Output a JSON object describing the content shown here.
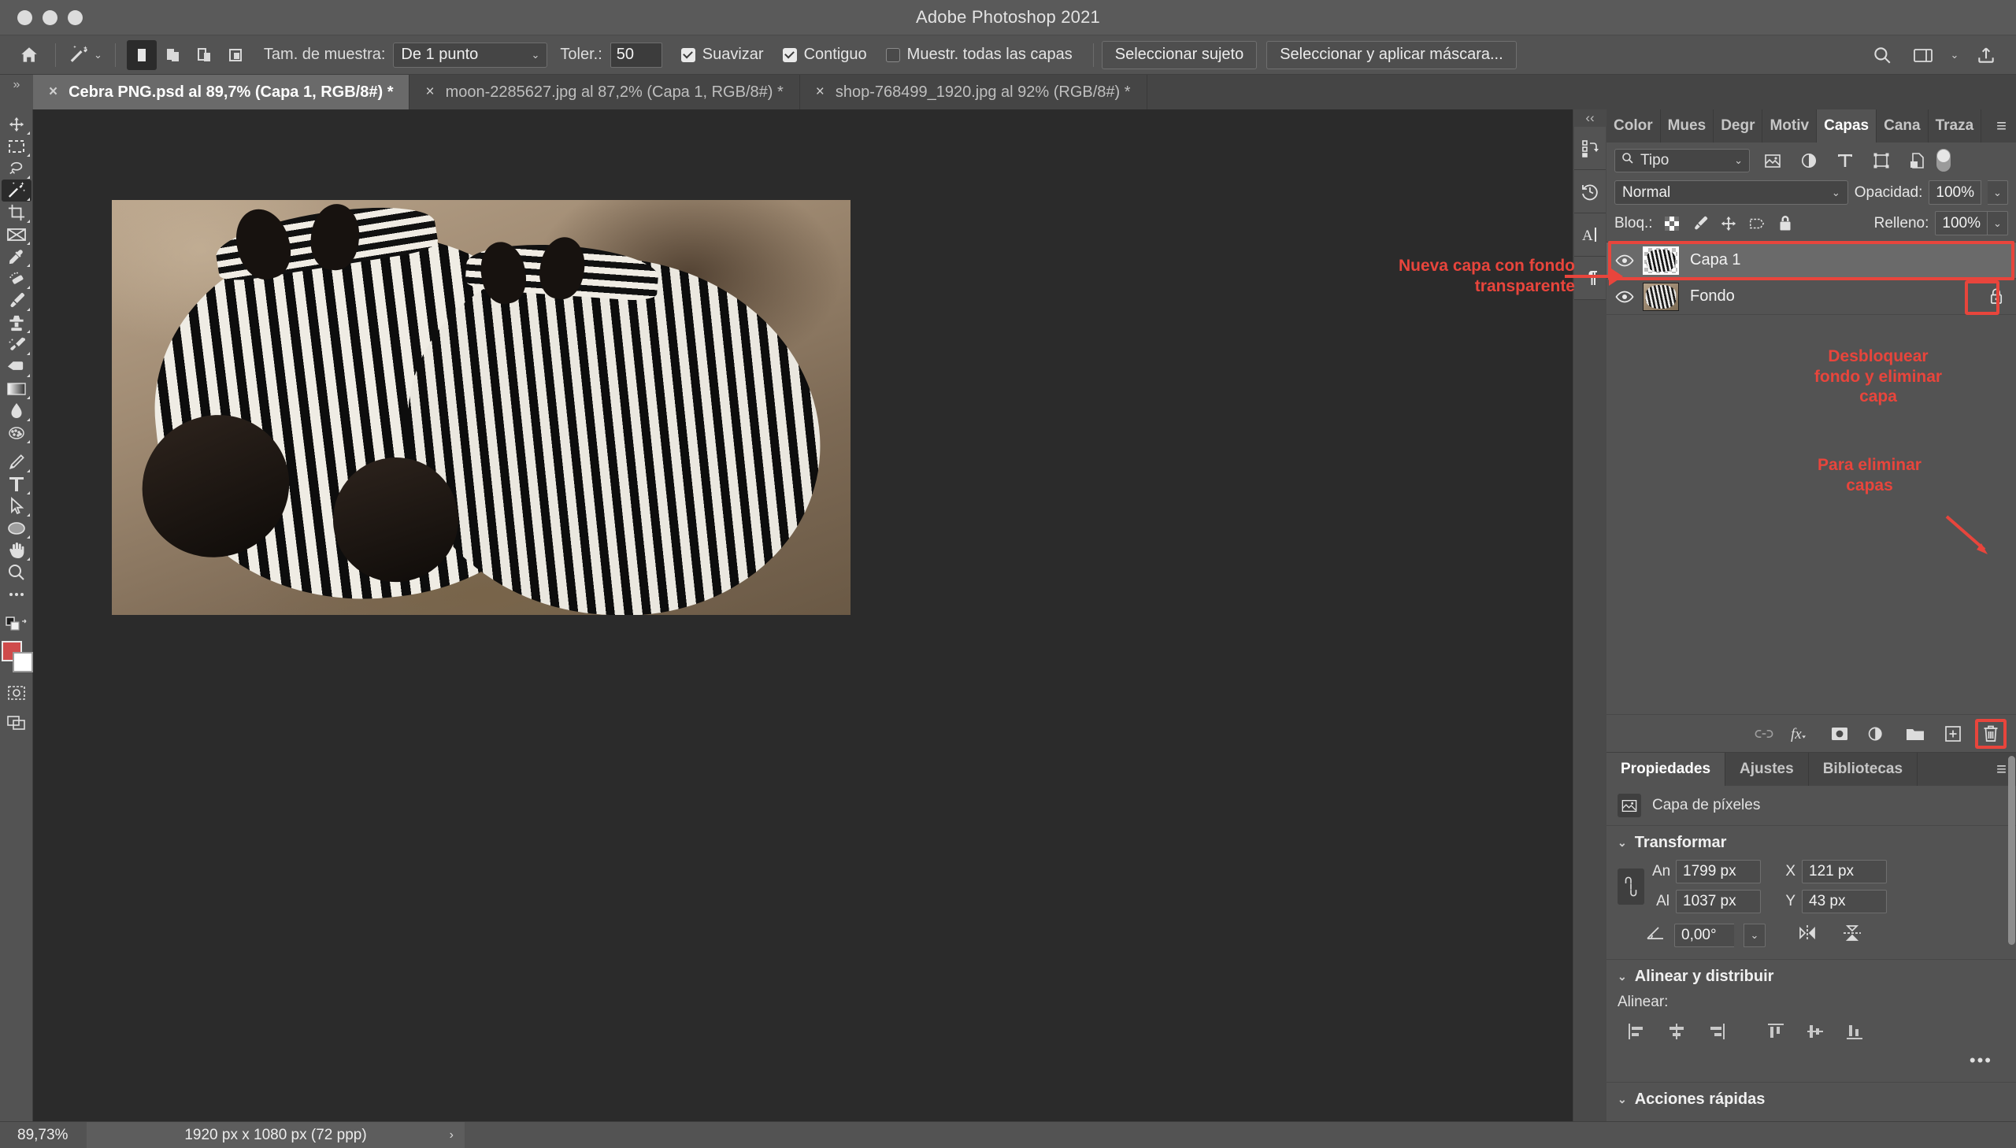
{
  "window": {
    "title": "Adobe Photoshop 2021"
  },
  "options_bar": {
    "home_icon": "home-icon",
    "tool_icon": "magic-wand-icon",
    "selection_modes": [
      "new-selection",
      "add-to-selection",
      "subtract-from-selection",
      "intersect-selection"
    ],
    "sample_size_label": "Tam. de muestra:",
    "sample_size_value": "De 1 punto",
    "tolerance_label": "Toler.:",
    "tolerance_value": "50",
    "checkboxes": [
      {
        "label": "Suavizar",
        "checked": true
      },
      {
        "label": "Contiguo",
        "checked": true
      },
      {
        "label": "Muestr. todas las capas",
        "checked": false
      }
    ],
    "select_subject_label": "Seleccionar sujeto",
    "select_and_mask_label": "Seleccionar y aplicar máscara...",
    "right_icons": [
      "search-icon",
      "workspace-icon",
      "chevron-down-icon",
      "share-icon"
    ]
  },
  "tabs": [
    {
      "label": "Cebra PNG.psd al 89,7% (Capa 1, RGB/8#) *",
      "active": true
    },
    {
      "label": "moon-2285627.jpg al 87,2% (Capa 1, RGB/8#) *",
      "active": false
    },
    {
      "label": "shop-768499_1920.jpg al 92% (RGB/8#) *",
      "active": false
    }
  ],
  "toolbar": {
    "tools": [
      "move-tool-icon",
      "rectangular-marquee-tool-icon",
      "lasso-tool-icon",
      "magic-wand-tool-icon",
      "crop-tool-icon",
      "frame-tool-icon",
      "eyedropper-tool-icon",
      "spot-healing-brush-tool-icon",
      "brush-tool-icon",
      "clone-stamp-tool-icon",
      "history-brush-tool-icon",
      "eraser-tool-icon",
      "gradient-tool-icon",
      "blur-tool-icon",
      "dodge-tool-icon",
      "pen-tool-icon",
      "type-tool-icon",
      "path-selection-tool-icon",
      "ellipse-tool-icon",
      "hand-tool-icon",
      "zoom-tool-icon",
      "edit-toolbar-icon"
    ],
    "active_tool": "magic-wand-tool-icon",
    "foreground_color": "#cf4b4b",
    "background_color": "#ffffff",
    "quick_mask_icon": "quick-mask-icon",
    "screen_mode_icon": "screen-mode-icon"
  },
  "rail": {
    "collapse_icon": "collapse-panels-icon",
    "buttons": [
      "actions-panel-icon",
      "history-panel-icon",
      "character-panel-icon",
      "paragraph-panel-icon"
    ]
  },
  "layers_panel": {
    "tabs": [
      {
        "label": "Color",
        "active": false
      },
      {
        "label": "Mues",
        "active": false
      },
      {
        "label": "Degr",
        "active": false
      },
      {
        "label": "Motiv",
        "active": false
      },
      {
        "label": "Capas",
        "active": true
      },
      {
        "label": "Cana",
        "active": false
      },
      {
        "label": "Traza",
        "active": false
      }
    ],
    "menu_icon": "panel-menu-icon",
    "filter": {
      "search_icon": "search-icon",
      "value": "Tipo",
      "chevron": "chevron-down-icon",
      "type_icons": [
        "pixel-filter-icon",
        "adjustment-filter-icon",
        "type-filter-icon",
        "shape-filter-icon",
        "smart-object-filter-icon"
      ],
      "toggle": "filter-toggle-switch"
    },
    "blend_mode": "Normal",
    "opacity_label": "Opacidad:",
    "opacity_value": "100%",
    "lock_label": "Bloq.:",
    "lock_icons": [
      "lock-transparent-pixels-icon",
      "lock-image-pixels-icon",
      "lock-position-icon",
      "lock-artboard-icon",
      "lock-all-icon"
    ],
    "fill_label": "Relleno:",
    "fill_value": "100%",
    "layers": [
      {
        "name": "Capa 1",
        "visible": true,
        "selected": true,
        "locked": false,
        "thumb": "transparent"
      },
      {
        "name": "Fondo",
        "visible": true,
        "selected": false,
        "locked": true,
        "thumb": "photo"
      }
    ],
    "footer_icons": [
      "link-layers-icon",
      "layer-style-fx-icon",
      "add-layer-mask-icon",
      "new-adjustment-layer-icon",
      "new-group-icon",
      "new-layer-icon",
      "delete-layer-icon"
    ]
  },
  "properties_panel": {
    "tabs": [
      {
        "label": "Propiedades",
        "active": true
      },
      {
        "label": "Ajustes",
        "active": false
      },
      {
        "label": "Bibliotecas",
        "active": false
      }
    ],
    "menu_icon": "panel-menu-icon",
    "layer_kind_icon": "pixel-layer-icon",
    "layer_kind": "Capa de píxeles",
    "transform": {
      "title": "Transformar",
      "link_icon": "link-aspect-ratio-icon",
      "width_label": "An",
      "width_value": "1799 px",
      "height_label": "Al",
      "height_value": "1037 px",
      "x_label": "X",
      "x_value": "121 px",
      "y_label": "Y",
      "y_value": "43 px",
      "angle_icon": "angle-icon",
      "angle_value": "0,00°",
      "flip_horizontal_icon": "flip-horizontal-icon",
      "flip_vertical_icon": "flip-vertical-icon"
    },
    "align": {
      "title": "Alinear y distribuir",
      "label": "Alinear:",
      "icons": [
        "align-left-edges-icon",
        "align-horizontal-centers-icon",
        "align-right-edges-icon",
        "align-top-edges-icon",
        "align-vertical-centers-icon",
        "align-bottom-edges-icon"
      ],
      "more_icon": "more-options-icon"
    },
    "quick_actions": {
      "title": "Acciones rápidas"
    }
  },
  "status_bar": {
    "zoom": "89,73%",
    "dimensions": "1920 px x 1080 px (72 ppp)",
    "expand_icon": "chevron-right-icon"
  },
  "annotations": [
    {
      "id": "new-layer-note",
      "lines": [
        "Nueva capa con fondo",
        "transparente"
      ]
    },
    {
      "id": "unlock-note",
      "lines": [
        "Desbloquear",
        "fondo y eliminar",
        "capa"
      ]
    },
    {
      "id": "delete-note",
      "lines": [
        "Para eliminar",
        "capas"
      ]
    }
  ],
  "colors": {
    "annotation": "#e8453c",
    "panel_bg": "#535353",
    "canvas_bg": "#2b2b2b"
  }
}
